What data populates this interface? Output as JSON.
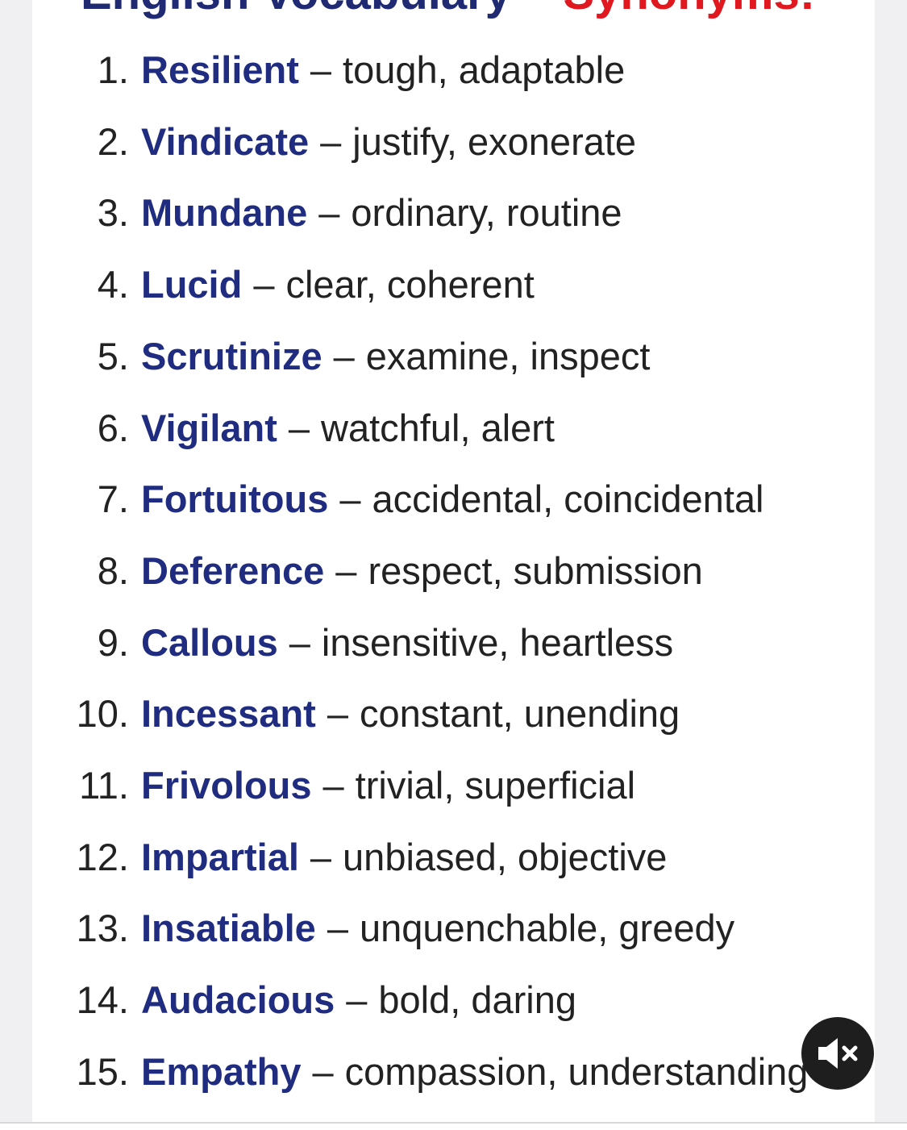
{
  "heading": {
    "main": "English Vocabulary – ",
    "accent": "Synonyms:"
  },
  "vocab": [
    {
      "num": "1.",
      "word": "Resilient",
      "sep": "–",
      "synonyms": "tough, adaptable"
    },
    {
      "num": "2.",
      "word": "Vindicate",
      "sep": "–",
      "synonyms": "justify, exonerate"
    },
    {
      "num": "3.",
      "word": "Mundane",
      "sep": "–",
      "synonyms": "ordinary, routine"
    },
    {
      "num": "4.",
      "word": "Lucid",
      "sep": "–",
      "synonyms": "clear, coherent"
    },
    {
      "num": "5.",
      "word": "Scrutinize",
      "sep": "–",
      "synonyms": "examine, inspect"
    },
    {
      "num": "6.",
      "word": "Vigilant",
      "sep": "–",
      "synonyms": "watchful, alert"
    },
    {
      "num": "7.",
      "word": "Fortuitous",
      "sep": "–",
      "synonyms": "accidental, coincidental"
    },
    {
      "num": "8.",
      "word": "Deference",
      "sep": "–",
      "synonyms": "respect, submission"
    },
    {
      "num": "9.",
      "word": "Callous",
      "sep": "–",
      "synonyms": "insensitive, heartless"
    },
    {
      "num": "10.",
      "word": "Incessant",
      "sep": "–",
      "synonyms": "constant, unending"
    },
    {
      "num": "11.",
      "word": "Frivolous",
      "sep": "–",
      "synonyms": "trivial, superficial"
    },
    {
      "num": "12.",
      "word": "Impartial",
      "sep": "–",
      "synonyms": "unbiased, objective"
    },
    {
      "num": "13.",
      "word": "Insatiable",
      "sep": "–",
      "synonyms": "unquenchable, greedy"
    },
    {
      "num": "14.",
      "word": "Audacious",
      "sep": "–",
      "synonyms": "bold, daring"
    },
    {
      "num": "15.",
      "word": "Empathy",
      "sep": "–",
      "synonyms": "compassion, understanding"
    }
  ],
  "colors": {
    "word": "#1f2c80",
    "accent": "#e0181f",
    "text": "#222222",
    "mute_button": "#1e1e1e"
  },
  "mute_button": {
    "icon": "speaker-muted-icon"
  }
}
